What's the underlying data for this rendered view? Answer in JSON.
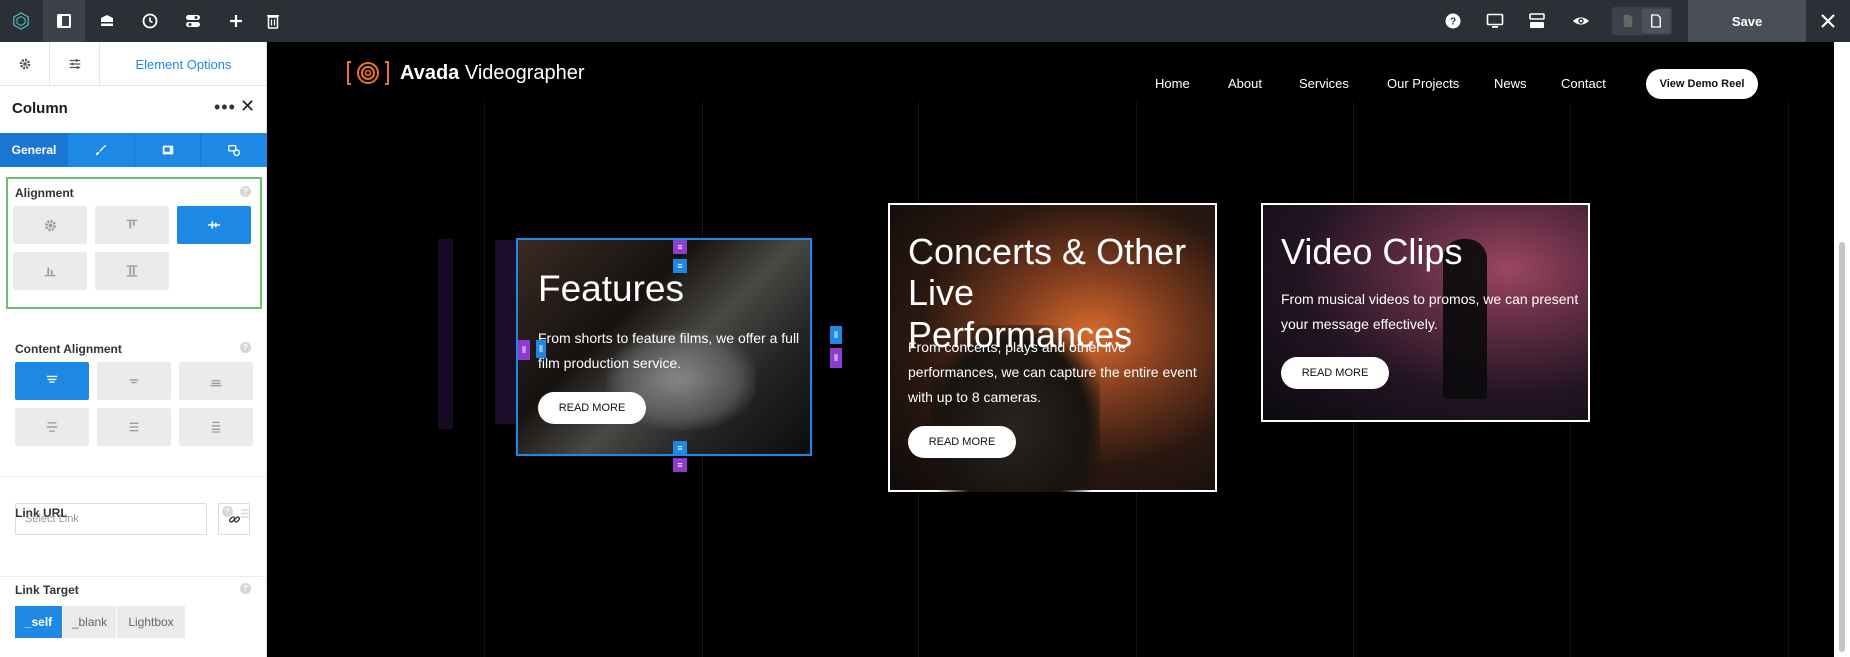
{
  "toolbar": {
    "save_label": "Save",
    "icons": [
      "avada-logo-icon",
      "sidebar-toggle-icon",
      "library-icon",
      "history-icon",
      "builder-options-icon",
      "add-icon",
      "delete-icon",
      "help-icon",
      "desktop-icon",
      "layout-icon",
      "preview-icon",
      "page-icon",
      "page-active-icon",
      "close-icon"
    ]
  },
  "sidebar": {
    "tab_label": "Element Options",
    "panel_title": "Column",
    "general_tab": "General",
    "alignment": {
      "label": "Alignment",
      "selected_index": 2
    },
    "content_alignment": {
      "label": "Content Alignment",
      "selected_index": 0
    },
    "link_url": {
      "label": "Link URL",
      "placeholder": "Select Link"
    },
    "link_target": {
      "label": "Link Target",
      "options": [
        "_self",
        "_blank",
        "Lightbox"
      ],
      "selected": "_self"
    }
  },
  "site": {
    "logo_bold": "Avada",
    "logo_rest": " Videographer",
    "nav": [
      "Home",
      "About",
      "Services",
      "Our Projects",
      "News",
      "Contact"
    ],
    "cta": "View Demo Reel",
    "accent_color": "#e8732a",
    "cards": [
      {
        "title": "Features",
        "text": "From shorts to feature films, we offer a full film production service.",
        "button": "READ MORE"
      },
      {
        "title": "Concerts & Other Live Performances",
        "text": "From concerts, plays and other live performances, we can capture the entire event with up to 8 cameras.",
        "button": "READ MORE"
      },
      {
        "title": "Video Clips",
        "text": "From musical videos to promos, we can present your message effectively.",
        "button": "READ MORE"
      }
    ]
  }
}
